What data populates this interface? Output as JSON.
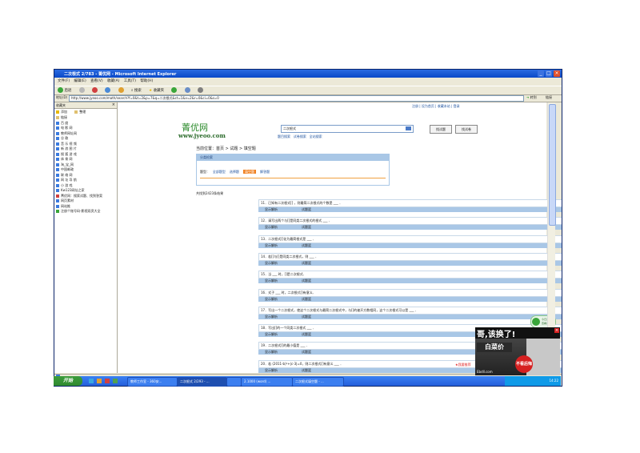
{
  "window": {
    "title": "二次根式 2/783 - 菁优网 - Microsoft Internet Explorer",
    "menu": [
      "文件(F)",
      "编辑(E)",
      "查看(V)",
      "收藏(A)",
      "工具(T)",
      "帮助(H)"
    ],
    "toolbar": {
      "back": "后退",
      "search": "搜索",
      "favorites": "收藏夹"
    },
    "address_label": "地址(D)",
    "address": "http://www.jyeoo.com/math/search?f=0&t=2&p=7&q=二次根式&ct=1&v=2&r=0&ci=0&s=0",
    "go": "转到",
    "links": "链接"
  },
  "sidebar": {
    "title": "收藏夹",
    "add": "添加",
    "organize": "整理",
    "items": [
      "链接",
      "百 度",
      "电 影 网",
      "教师网址网",
      "谷 歌",
      "音 乐 视 频",
      "新 浪 图 片",
      "搜 狐 游 戏",
      "体 育 网",
      "淘_宝_网",
      "中国邮政",
      "联 络 网",
      "网 址 导 航",
      "小 游 戏",
      "Kw123网址之家",
      "菁优网：搜索试题、找到答案",
      "网页素材",
      "网站推",
      "注册个账号码-影视双资大全"
    ]
  },
  "page": {
    "top_links": "注册 | 设为首页 | 收藏本站 | 登录",
    "logo_cn": "菁优网",
    "logo_url": "www.jyeoo.com",
    "search_value": "二次根式",
    "search_tabs": [
      "题目搜索",
      "试卷搜索",
      "全站搜索"
    ],
    "btn_search_questions": "找试题",
    "btn_search_papers": "找试卷",
    "breadcrumb": "当前位置：首页 > 试题 > 填空题",
    "cat_title": "分类检索",
    "cat_label": "题型：",
    "categories": [
      "全部题型",
      "选择题",
      "填空题",
      "解答题"
    ],
    "result_count": "共找到2423条结果",
    "show_answer": "显示解析",
    "add_basket": "试题篮",
    "questions": [
      "11．已知有二次根式[] ，则最简二次根式的个数是 ___ ．",
      "12．请写出两个与[]是同类二次根式的根式 ___ ．",
      "13．二次根式[]化为最简根式是 ___ ．",
      "14．若[]与[]是同类二次根式，则 ___ ．",
      "15．当 ___ 时，[]是二次根式．",
      "16．式子 ___ 时，二次根式[]有意义．",
      "17．写出一个二次根式，使这个二次根式与最简二次根式中，与[]的被开方数相同，这个二次根式可以是 ___ ．",
      "18．写出[]的一个同类二次根式 ___ ．",
      "19．二次根式[]的最小值是 ___ ．",
      "20．若 (2011-b)²+|c-3|=0，则二次根式[]有意义 ___ ．"
    ],
    "hot_tag": "★我要推荐"
  },
  "float_widget": [
    "今日活跃度",
    "查看详情"
  ],
  "ad": {
    "headline": "哥,该换了!",
    "product": "白菜价",
    "sticker": "不看后悔",
    "brand": "Ebdll.com"
  },
  "taskbar": {
    "start": "开始",
    "tasks": [
      "教师工作室 - 360安...",
      "二次根式 2/293 - ...",
      "",
      "2.1000 (word) ...",
      "二次根式填空题 - ..."
    ],
    "clock": "14:22"
  },
  "colors": {
    "title": "#0a49c8",
    "accent": "#e02020",
    "link": "#1a4f9c"
  }
}
